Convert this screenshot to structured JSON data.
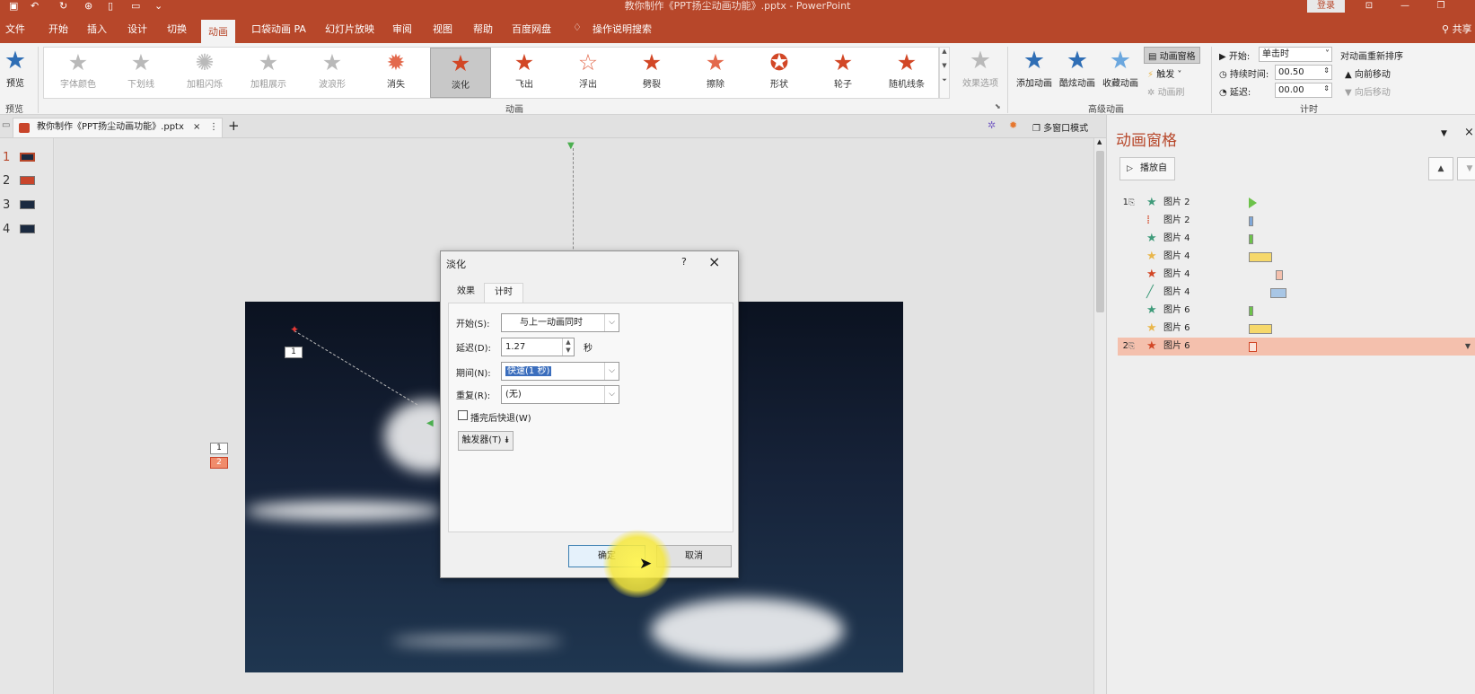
{
  "titlebar": {
    "doc_title": "教你制作《PPT扬尘动画功能》.pptx - PowerPoint",
    "login": "登录",
    "qa_icons": [
      "save-icon",
      "undo-icon",
      "redo-icon",
      "touch-icon",
      "new-icon",
      "open-icon",
      "customize-icon"
    ]
  },
  "menu": {
    "items": [
      "文件",
      "开始",
      "插入",
      "设计",
      "切换",
      "动画",
      "口袋动画 PA",
      "幻灯片放映",
      "审阅",
      "视图",
      "帮助",
      "百度网盘"
    ],
    "search": "操作说明搜索",
    "share": "共享"
  },
  "ribbon": {
    "preview": {
      "label": "预览",
      "group": "预览"
    },
    "gallery_group": "动画",
    "animations": [
      {
        "label": "字体颜色",
        "state": "dim",
        "glyph": "A"
      },
      {
        "label": "下划线",
        "state": "dim",
        "glyph": "U"
      },
      {
        "label": "加粗闪烁",
        "state": "dim",
        "glyph": "B"
      },
      {
        "label": "加粗展示",
        "state": "dim",
        "glyph": "B"
      },
      {
        "label": "波浪形",
        "state": "dim",
        "glyph": "A"
      },
      {
        "label": "消失",
        "state": "red",
        "glyph": "✸"
      },
      {
        "label": "淡化",
        "state": "selected",
        "glyph": "★"
      },
      {
        "label": "飞出",
        "state": "red",
        "glyph": "★"
      },
      {
        "label": "浮出",
        "state": "red",
        "glyph": "☆"
      },
      {
        "label": "劈裂",
        "state": "red",
        "glyph": "★"
      },
      {
        "label": "擦除",
        "state": "red",
        "glyph": "★"
      },
      {
        "label": "形状",
        "state": "red",
        "glyph": "✪"
      },
      {
        "label": "轮子",
        "state": "red",
        "glyph": "★"
      },
      {
        "label": "随机线条",
        "state": "red",
        "glyph": "★"
      }
    ],
    "effect_options": "效果选项",
    "advanced": {
      "add_animation": "添加动画",
      "cool_animation": "酷炫动画",
      "fav_animation": "收藏动画",
      "pane": "动画窗格",
      "trigger": "触发",
      "painter": "动画刷",
      "group": "高级动画"
    },
    "timing": {
      "start_label": "开始:",
      "start_value": "单击时",
      "duration_label": "持续时间:",
      "duration_value": "00.50",
      "delay_label": "延迟:",
      "delay_value": "00.00",
      "reorder": "对动画重新排序",
      "move_earlier": "向前移动",
      "move_later": "向后移动",
      "group": "计时"
    }
  },
  "doc_tab": {
    "name": "教你制作《PPT扬尘动画功能》.pptx",
    "plus": "+",
    "multi_window": "多窗口模式"
  },
  "slides": [
    "1",
    "2",
    "3",
    "4"
  ],
  "slide_tags": [
    "1",
    "2"
  ],
  "path_tag": "1",
  "dialog": {
    "title": "淡化",
    "help": "?",
    "tabs": [
      "效果",
      "计时"
    ],
    "start_label": "开始(S):",
    "start_value": "与上一动画同时",
    "delay_label": "延迟(D):",
    "delay_value": "1.27",
    "delay_unit": "秒",
    "period_label": "期间(N):",
    "period_value": "快速(1 秒)",
    "repeat_label": "重复(R):",
    "repeat_value": "(无)",
    "rewind_label": "播完后快退(W)",
    "rewind_checked": false,
    "trigger_label": "触发器(T)",
    "ok": "确定",
    "cancel": "取消"
  },
  "pane": {
    "title": "动画窗格",
    "play_from": "播放自",
    "rows": [
      {
        "seq": "1",
        "mouse": true,
        "icon": "★",
        "icon_color": "#3f9b7a",
        "name": "图片 2",
        "bar_color": "#6cc24a",
        "bar_type": "triangle",
        "selected": false
      },
      {
        "seq": "",
        "mouse": false,
        "icon": "⁞",
        "icon_color": "#d24726",
        "name": "图片 2",
        "bar_color": "#7fa7d8",
        "bar_type": "bar",
        "selected": false
      },
      {
        "seq": "",
        "mouse": false,
        "icon": "★",
        "icon_color": "#3f9b7a",
        "name": "图片 4",
        "bar_color": "#6cc24a",
        "bar_type": "bar",
        "selected": false
      },
      {
        "seq": "",
        "mouse": false,
        "icon": "★",
        "icon_color": "#e9b64b",
        "name": "图片 4",
        "bar_color": "#f6d86b",
        "bar_type": "bar",
        "selected": false
      },
      {
        "seq": "",
        "mouse": false,
        "icon": "★",
        "icon_color": "#d24726",
        "name": "图片 4",
        "bar_color": "#f4c0ad",
        "bar_type": "bar",
        "selected": false
      },
      {
        "seq": "",
        "mouse": false,
        "icon": "╱",
        "icon_color": "#3f9b7a",
        "name": "图片 4",
        "bar_color": "#a8c6e5",
        "bar_type": "bar",
        "selected": false
      },
      {
        "seq": "",
        "mouse": false,
        "icon": "★",
        "icon_color": "#3f9b7a",
        "name": "图片 6",
        "bar_color": "#6cc24a",
        "bar_type": "bar",
        "selected": false
      },
      {
        "seq": "",
        "mouse": false,
        "icon": "★",
        "icon_color": "#e9b64b",
        "name": "图片 6",
        "bar_color": "#f6d86b",
        "bar_type": "bar",
        "selected": false
      },
      {
        "seq": "2",
        "mouse": true,
        "icon": "★",
        "icon_color": "#d24726",
        "name": "图片 6",
        "bar_color": "#f4c0ad",
        "bar_type": "bar",
        "selected": true
      }
    ]
  },
  "colors": {
    "brand": "#b7472a",
    "accent_red": "#d24726",
    "selection": "#f4c0ad"
  }
}
